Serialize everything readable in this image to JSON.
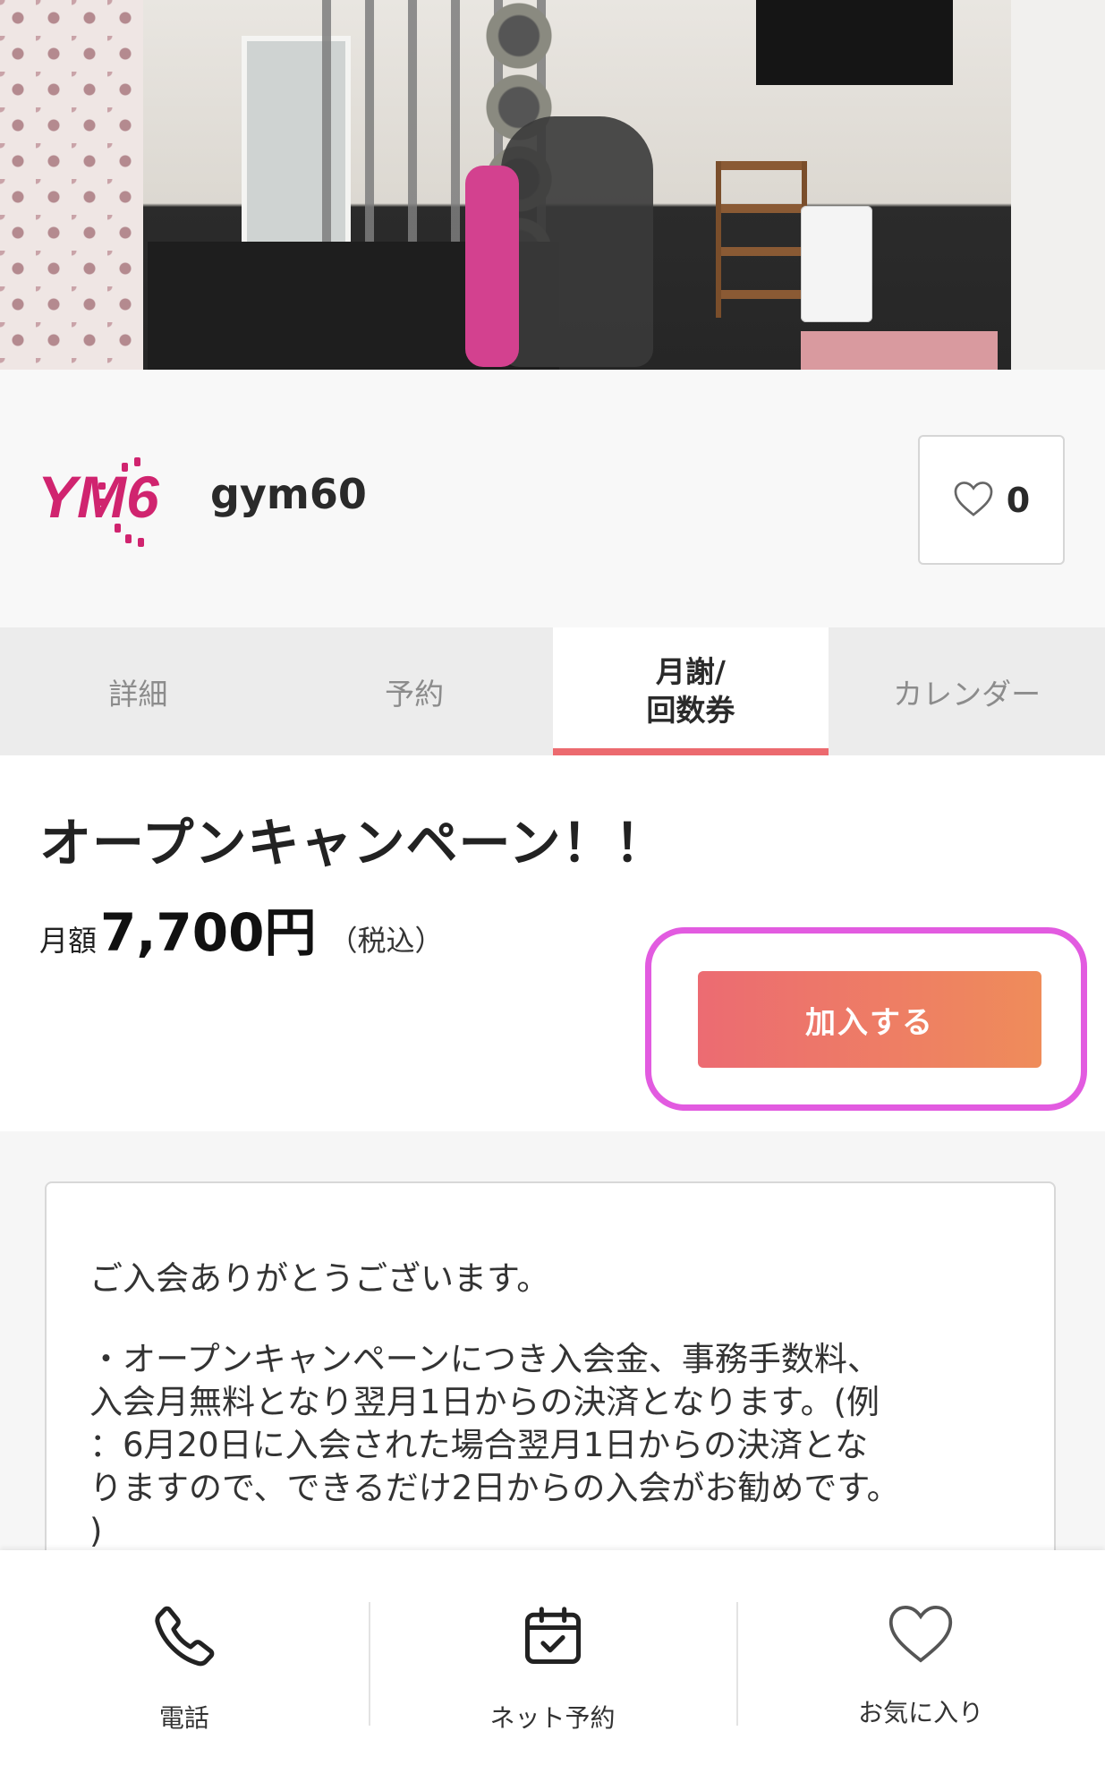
{
  "store": {
    "name": "gym60",
    "favorite_count": "0",
    "logo_text": "YM6"
  },
  "tabs": [
    {
      "label": "詳細"
    },
    {
      "label": "予約"
    },
    {
      "label": "月謝/\n回数券",
      "active": true
    },
    {
      "label": "カレンダー"
    }
  ],
  "plan": {
    "title": "オープンキャンペーン！！",
    "price_label": "月額",
    "price_amount": "7,700円",
    "price_tax": "（税込）",
    "join_label": "加入する"
  },
  "description": {
    "greeting": "ご入会ありがとうございます。",
    "body": "・オープンキャンペーンにつき入会金、事務手数料、\n入会月無料となり翌月1日からの決済となります。(例\n：6月20日に入会された場合翌月1日からの決済とな\nりますので、できるだけ2日からの入会がお勧めです。\n)"
  },
  "bottom_nav": [
    {
      "label": "電話",
      "icon": "phone-icon"
    },
    {
      "label": "ネット予約",
      "icon": "calendar-check-icon"
    },
    {
      "label": "お気に入り",
      "icon": "heart-icon"
    }
  ],
  "colors": {
    "accent": "#ec6a6f",
    "button_gradient_start": "#ec6b72",
    "button_gradient_end": "#ef8c5a",
    "highlight_ring": "#e25be0",
    "logo": "#d0246f"
  }
}
